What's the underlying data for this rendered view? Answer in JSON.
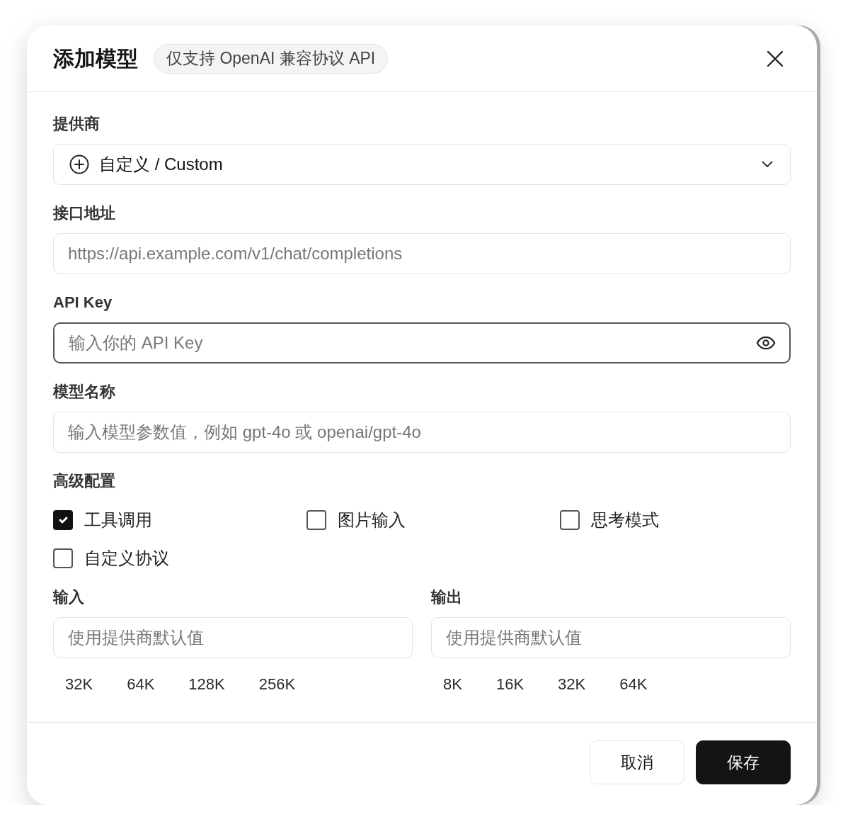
{
  "dialog": {
    "title": "添加模型",
    "tag": "仅支持 OpenAI 兼容协议 API"
  },
  "fields": [
    {
      "kind": "select",
      "label": "提供商",
      "value": "自定义 / Custom",
      "focused": false
    },
    {
      "kind": "text",
      "label": "接口地址",
      "placeholder": "https://api.example.com/v1/chat/completions",
      "focused": false
    },
    {
      "kind": "secret",
      "label": "API Key",
      "placeholder": "输入你的 API Key",
      "focused": true
    },
    {
      "kind": "text",
      "label": "模型名称",
      "placeholder": "输入模型参数值，例如 gpt-4o 或 openai/gpt-4o",
      "focused": false
    }
  ],
  "advanced": {
    "label": "高级配置",
    "options": [
      {
        "label": "工具调用",
        "checked": true
      },
      {
        "label": "图片输入",
        "checked": false
      },
      {
        "label": "思考模式",
        "checked": false
      },
      {
        "label": "自定义协议",
        "checked": false
      }
    ]
  },
  "limits": [
    {
      "label": "输入",
      "placeholder": "使用提供商默认值",
      "presets": [
        "32K",
        "64K",
        "128K",
        "256K"
      ]
    },
    {
      "label": "输出",
      "placeholder": "使用提供商默认值",
      "presets": [
        "8K",
        "16K",
        "32K",
        "64K"
      ]
    }
  ],
  "buttons": [
    {
      "kind": "secondary",
      "label": "取消"
    },
    {
      "kind": "primary",
      "label": "保存"
    }
  ]
}
